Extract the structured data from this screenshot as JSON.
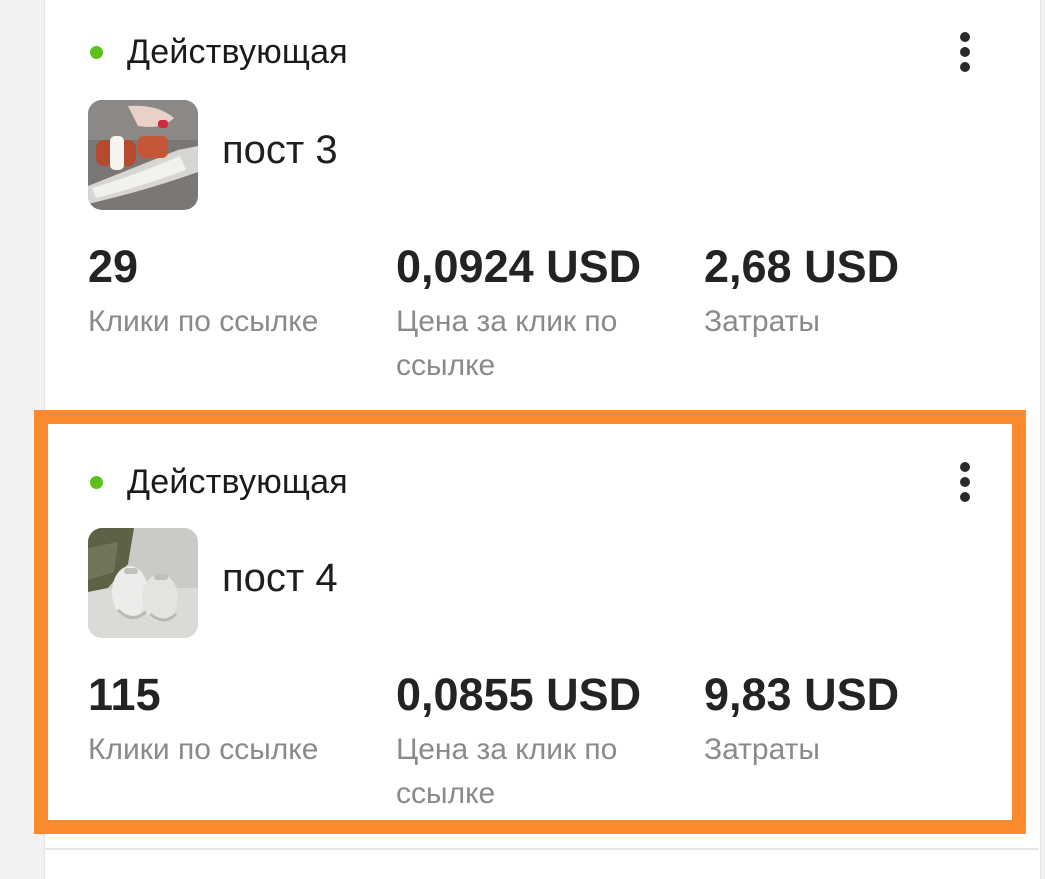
{
  "cards": [
    {
      "status": "Действующая",
      "title": "пост 3",
      "thumbnail": "sandal-photo",
      "metrics": [
        {
          "value": "29",
          "label": "Клики по ссылке"
        },
        {
          "value": "0,0924 USD",
          "label": "Цена за клик по ссылке"
        },
        {
          "value": "2,68 USD",
          "label": "Затраты"
        }
      ]
    },
    {
      "status": "Действующая",
      "title": "пост 4",
      "thumbnail": "sneakers-photo",
      "metrics": [
        {
          "value": "115",
          "label": "Клики по ссылке"
        },
        {
          "value": "0,0855 USD",
          "label": "Цена за клик по ссылке"
        },
        {
          "value": "9,83 USD",
          "label": "Затраты"
        }
      ]
    }
  ],
  "colors": {
    "status_active": "#5cc21a",
    "highlight": "#fb8a2e",
    "label_gray": "#8a8a8a"
  },
  "icons": {
    "more": "vertical-ellipsis-icon",
    "status": "green-dot-icon"
  }
}
